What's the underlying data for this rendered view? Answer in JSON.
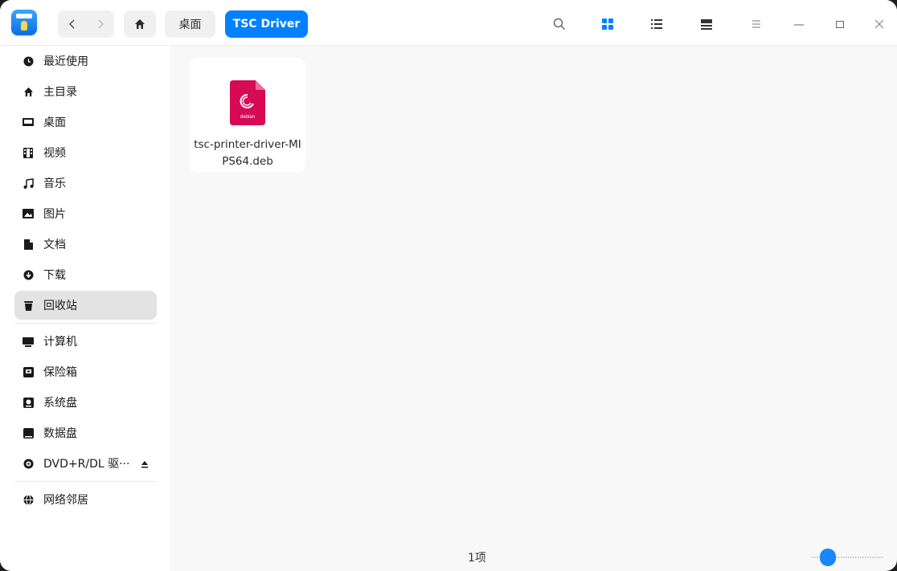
{
  "app": {
    "logo_icon": "file-manager-logo-icon"
  },
  "nav": {
    "back_icon": "chevron-left-icon",
    "forward_icon": "chevron-right-icon",
    "home_icon": "home-icon"
  },
  "breadcrumb": {
    "items": [
      "桌面",
      "TSC Driver"
    ]
  },
  "toolbar": {
    "icons": [
      "search-icon",
      "icon-view-icon",
      "list-view-icon",
      "tree-view-icon",
      "menu-icon",
      "minimize-icon",
      "maximize-icon",
      "close-icon"
    ]
  },
  "sidebar": {
    "items": [
      {
        "label": "最近使用",
        "icon": "recent-clock-icon"
      },
      {
        "label": "主目录",
        "icon": "home-icon"
      },
      {
        "label": "桌面",
        "icon": "desktop-icon"
      },
      {
        "label": "视频",
        "icon": "video-icon"
      },
      {
        "label": "音乐",
        "icon": "music-icon"
      },
      {
        "label": "图片",
        "icon": "picture-icon"
      },
      {
        "label": "文档",
        "icon": "document-icon"
      },
      {
        "label": "下载",
        "icon": "download-icon"
      },
      {
        "label": "回收站",
        "icon": "trash-icon",
        "active": true
      },
      {
        "label": "计算机",
        "icon": "computer-icon"
      },
      {
        "label": "保险箱",
        "icon": "vault-icon"
      },
      {
        "label": "系统盘",
        "icon": "system-disk-icon"
      },
      {
        "label": "数据盘",
        "icon": "data-disk-icon"
      },
      {
        "label": "DVD+R/DL 驱···",
        "icon": "dvd-icon",
        "eject_icon": "eject-icon"
      },
      {
        "label": "网络邻居",
        "icon": "network-icon"
      }
    ]
  },
  "files": [
    {
      "name": "tsc-printer-driver-MIPS64.deb",
      "icon": "debian-package-icon",
      "icon_label": "debian"
    }
  ],
  "status": {
    "count_text": "1项"
  },
  "zoom": {
    "level": 0.15
  },
  "colors": {
    "accent": "#0081ff",
    "debian": "#d70a53"
  }
}
